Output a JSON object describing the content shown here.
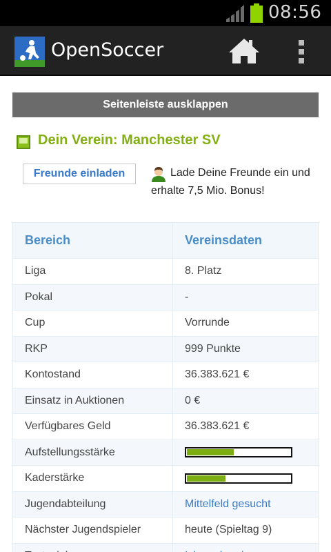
{
  "status_bar": {
    "time": "08:56",
    "battery_color": "#8fd400"
  },
  "action_bar": {
    "title": "OpenSoccer",
    "home_icon": "home-icon",
    "menu_icon": "overflow-menu-icon"
  },
  "sidebar_toggle": {
    "label": "Seitenleiste ausklappen"
  },
  "club": {
    "title": "Dein Verein: Manchester SV",
    "accent_color": "#84b014"
  },
  "invite": {
    "button_label": "Freunde einladen",
    "promo_text": "Lade Deine Freunde ein und erhalte 7,5 Mio. Bonus!"
  },
  "table": {
    "headers": [
      "Bereich",
      "Vereinsdaten"
    ],
    "rows": [
      {
        "label": "Liga",
        "value": "8. Platz"
      },
      {
        "label": "Pokal",
        "value": "-"
      },
      {
        "label": "Cup",
        "value": "Vorrunde"
      },
      {
        "label": "RKP",
        "value": "999 Punkte"
      },
      {
        "label": "Kontostand",
        "value": "36.383.621 €"
      },
      {
        "label": "Einsatz in Auktionen",
        "value": "0 €"
      },
      {
        "label": "Verfügbares Geld",
        "value": "36.383.621 €"
      },
      {
        "label": "Aufstellungsstärke",
        "progress": 0.45
      },
      {
        "label": "Kaderstärke",
        "progress": 0.37
      },
      {
        "label": "Jugendabteilung",
        "value": "Mittelfeld gesucht",
        "link": true
      },
      {
        "label": "Nächster Jugendspieler",
        "value": "heute (Spieltag 9)"
      },
      {
        "label": "Testspiele",
        "value": "Ich suche einen",
        "link": true
      }
    ]
  }
}
